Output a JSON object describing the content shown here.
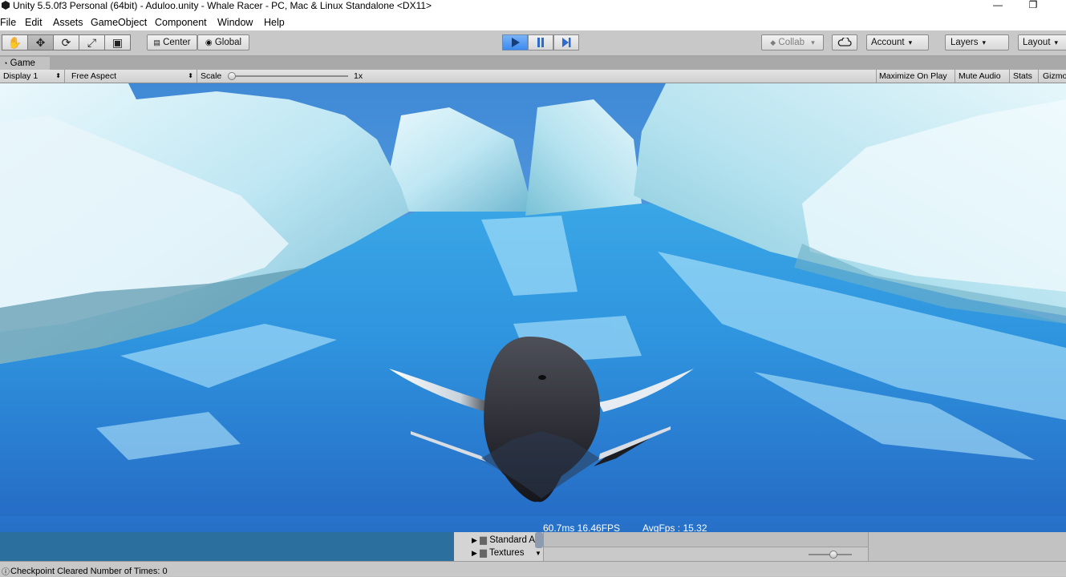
{
  "window": {
    "title": "Unity 5.5.0f3 Personal (64bit) - Aduloo.unity - Whale Racer - PC, Mac & Linux Standalone <DX11>",
    "minimize_glyph": "—",
    "restore_glyph": "❐"
  },
  "menu": [
    "File",
    "Edit",
    "Assets",
    "GameObject",
    "Component",
    "Window",
    "Help"
  ],
  "toolbar": {
    "tools": [
      "hand-icon",
      "move-icon",
      "rotate-icon",
      "scale-icon",
      "rect-tool-icon"
    ],
    "pivot_label": "Center",
    "space_label": "Global",
    "play_icons": [
      "play-icon",
      "pause-icon",
      "step-icon"
    ],
    "collab_label": "Collab",
    "account_label": "Account",
    "layers_label": "Layers",
    "layout_label": "Layout",
    "play_active_color": "#3c8af0"
  },
  "game_view": {
    "tab_label": "Game",
    "display_label": "Display 1",
    "aspect_label": "Free Aspect",
    "scale_label": "Scale",
    "scale_value": "1x",
    "maximize_label": "Maximize On Play",
    "mute_label": "Mute Audio",
    "stats_label": "Stats",
    "gizmos_label": "Gizmos",
    "fps_text": "60.7ms 16.46FPS",
    "avgfps_text": "AvgFps : 15.32"
  },
  "project_panel": {
    "folders": [
      "Standard Assets",
      "Textures"
    ]
  },
  "status": {
    "message": "Checkpoint Cleared Number of Times: 0"
  }
}
